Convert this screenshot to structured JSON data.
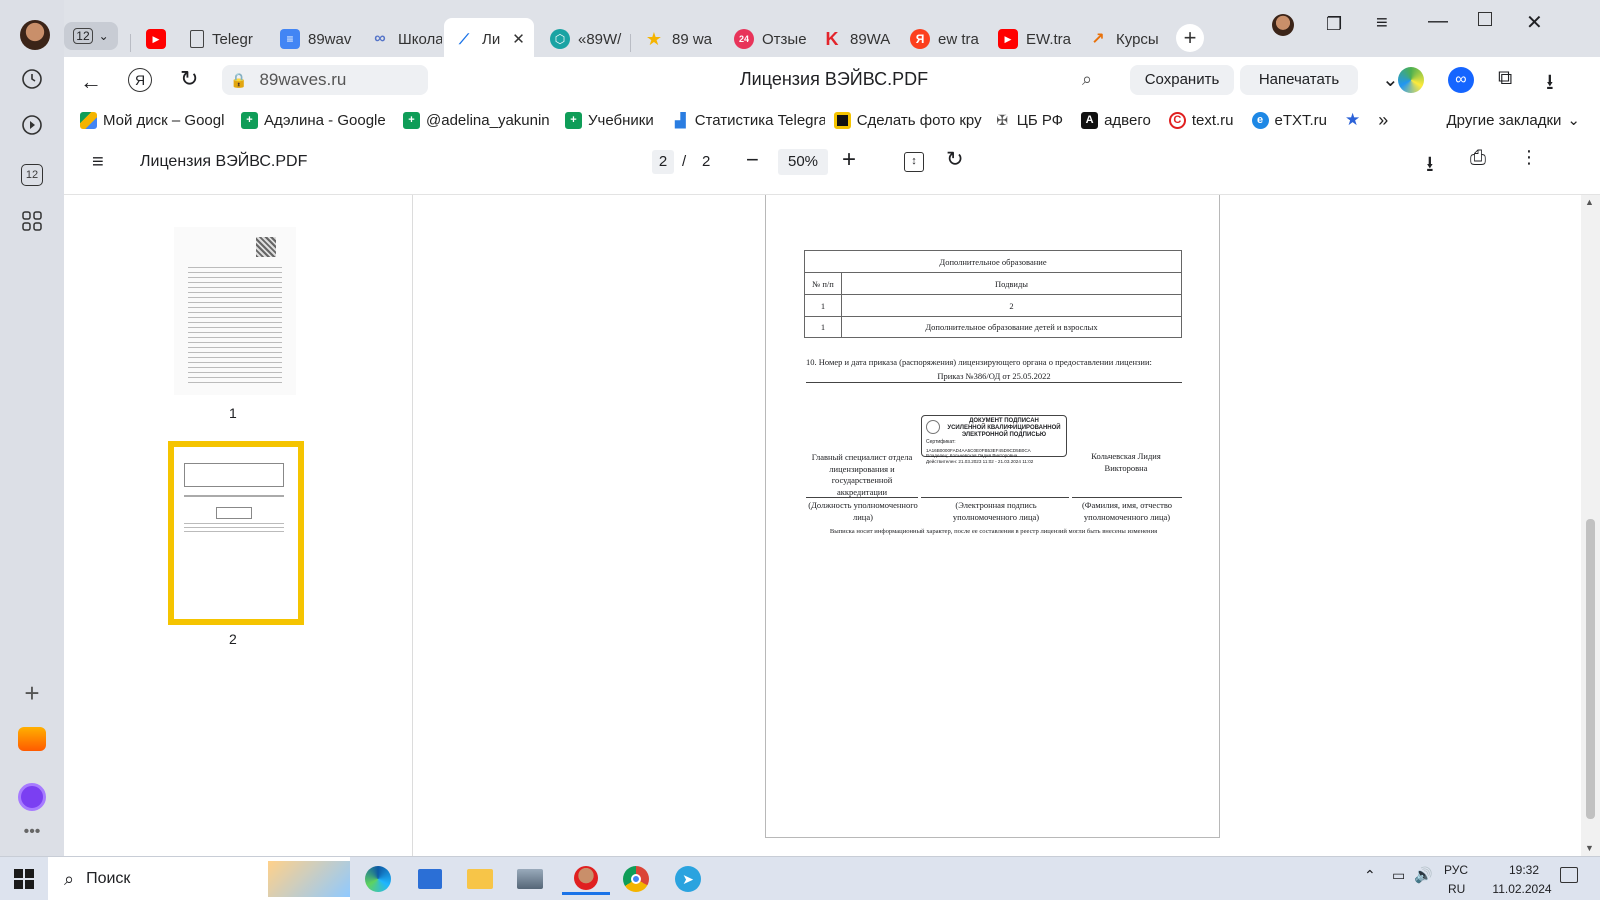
{
  "tabbar": {
    "tab_count": "12",
    "tabs": [
      {
        "label": ""
      },
      {
        "label": "Telegr"
      },
      {
        "label": "89wav"
      },
      {
        "label": "Школа"
      },
      {
        "label": "Ли"
      },
      {
        "label": "«89W/"
      },
      {
        "label": "89 wa"
      },
      {
        "label": "Отзые"
      },
      {
        "label": "89WA"
      },
      {
        "label": "ew tra"
      },
      {
        "label": "EW.tra"
      },
      {
        "label": "Курсы"
      }
    ]
  },
  "address": {
    "domain": "89waves.ru",
    "page_title": "Лицензия ВЭЙВС.PDF",
    "save_label": "Сохранить",
    "print_label": "Напечатать"
  },
  "bookmarks": {
    "items": [
      {
        "label": "Мой диск – Googl"
      },
      {
        "label": "Адэлина - Google"
      },
      {
        "label": "@adelina_yakunin"
      },
      {
        "label": "Учебники"
      },
      {
        "label": "Статистика Telegra"
      },
      {
        "label": "Сделать фото кру"
      },
      {
        "label": "ЦБ РФ"
      },
      {
        "label": "адвего"
      },
      {
        "label": "text.ru"
      },
      {
        "label": "eTXT.ru"
      }
    ],
    "more": "»",
    "other_label": "Другие закладки"
  },
  "viewer": {
    "doc_title": "Лицензия ВЭЙВС.PDF",
    "current_page": "2",
    "page_sep": "/",
    "total_pages": "2",
    "zoom": "50%",
    "thumb1_label": "1",
    "thumb2_label": "2"
  },
  "document": {
    "table_title": "Дополнительное образование",
    "col1_header": "№ п/п",
    "col2_header": "Подвиды",
    "row1_c1": "1",
    "row1_c2": "2",
    "row2_c1": "1",
    "row2_c2": "Дополнительное образование детей и взрослых",
    "item10": "10. Номер и дата приказа (распоряжения) лицензирующего органа о предоставлении лицензии:",
    "order": "Приказ №386/ОД от 25.05.2022",
    "stamp_line1": "ДОКУМЕНТ ПОДПИСАН",
    "stamp_line2": "УСИЛЕННОЙ КВАЛИФИЦИРОВАННОЙ",
    "stamp_line3": "ЭЛЕКТРОННОЙ ПОДПИСЬЮ",
    "stamp_cert": "Сертификат:",
    "stamp_serial": "1A16B0000FAD4AA5C0E0FB53EF45D9CD5B0CA",
    "stamp_owner": "Владелец: Кольчевская Лидия Викторовна",
    "stamp_valid": "Действителен: 21.03.2023 11:02 - 21.03.2024 11:02",
    "position": "Главный специалист отдела лицензирования и государственной аккредитации",
    "name": "Кольчевская Лидия Викторовна",
    "caption1": "(Должность уполномоченного лица)",
    "caption2": "(Электронная подпись уполномоченного лица)",
    "caption3": "(Фамилия, имя, отчество уполномоченного лица)",
    "footnote": "Выписка носит информационный характер, после ее составления в реестр лицензий могли быть внесены изменения"
  },
  "taskbar": {
    "search_label": "Поиск",
    "lang1": "РУС",
    "lang2": "RU",
    "time": "19:32",
    "date": "11.02.2024"
  },
  "colors": {
    "thumb_highlight": "#f5c400",
    "accent": "#1a73e8"
  }
}
